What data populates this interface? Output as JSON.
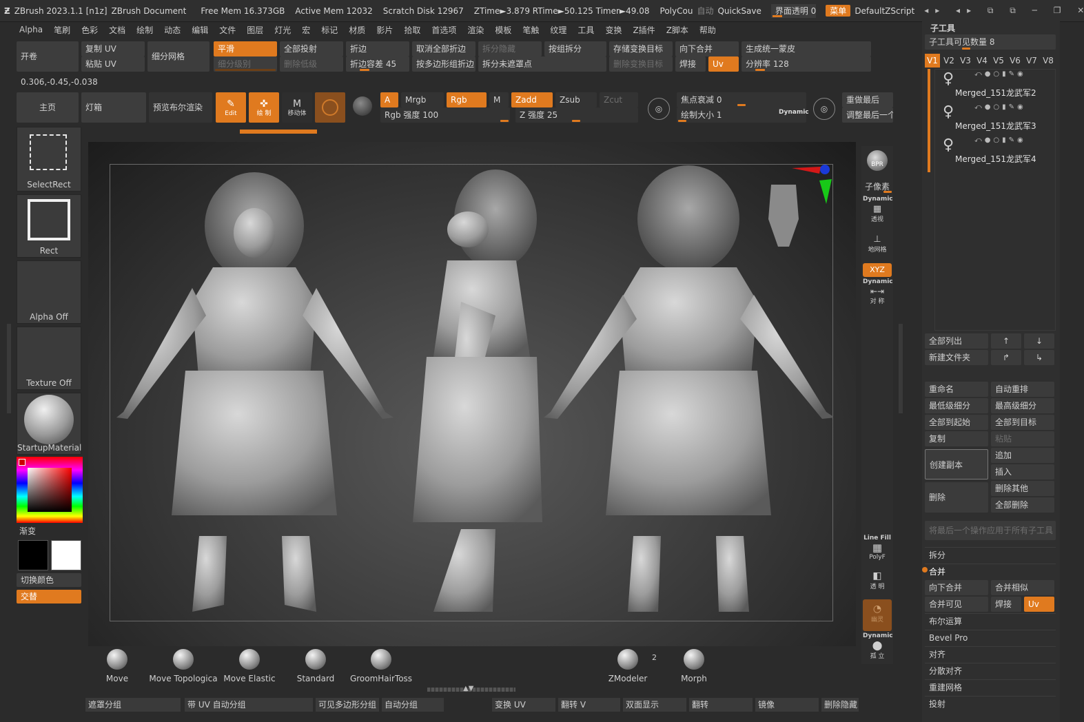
{
  "titlebar": {
    "app": "ZBrush 2023.1.1 [n1z]",
    "doc": "ZBrush Document",
    "free_mem": "Free Mem 16.373GB",
    "active_mem": "Active Mem 12032",
    "scratch": "Scratch Disk 12967",
    "ztime": "ZTime►3.879 RTime►50.125 Timer►49.08",
    "polycount": "PolyCou",
    "auto": "自动",
    "quicksave": "QuickSave",
    "transparency": "界面透明 0",
    "menu": "菜单",
    "script": "DefaultZScript"
  },
  "menu": [
    "Alpha",
    "笔刷",
    "色彩",
    "文档",
    "绘制",
    "动态",
    "编辑",
    "文件",
    "图层",
    "灯光",
    "宏",
    "标记",
    "材质",
    "影片",
    "拾取",
    "首选项",
    "渲染",
    "模板",
    "笔触",
    "纹理",
    "工具",
    "变换",
    "Z插件",
    "Z脚本",
    "帮助"
  ],
  "toolbar1": {
    "kaijuan": "开卷",
    "copy_uv": "复制 UV",
    "paste_uv": "粘贴 UV",
    "subdivide": "细分网格",
    "smooth": "平滑",
    "sub_level": "细分级别",
    "project_all": "全部投射",
    "del_lower": "删除低级",
    "crease": "折边",
    "crease_tol": "折边容差 45",
    "uncrease_all": "取消全部折边",
    "crease_pg": "按多边形组折边",
    "split_hidden": "拆分隐藏",
    "split_unmasked": "拆分未遮罩点",
    "groups_split": "按组拆分",
    "store_morph": "存储变换目标",
    "del_morph": "删除变换目标",
    "merge_down": "向下合并",
    "weld": "焊接",
    "uv": "Uv",
    "unified_skin": "生成统一蒙皮",
    "resolution": "分辨率 128"
  },
  "coords": "0.306,-0.45,-0.038",
  "toolbar2": {
    "home": "主页",
    "lightbox": "灯箱",
    "bpr_preview": "预览布尔渲染",
    "edit": "Edit",
    "draw": "绘 制",
    "move": "移动体",
    "a": "A",
    "mrgb": "Mrgb",
    "rgb": "Rgb",
    "m": "M",
    "zadd": "Zadd",
    "zsub": "Zsub",
    "zcut": "Zcut",
    "rgb_intensity": "Rgb 强度 100",
    "z_intensity": "Z 强度 25",
    "focal": "焦点衰减 0",
    "draw_size": "绘制大小 1",
    "dynamic": "Dynamic",
    "redo_last": "重做最后",
    "adjust_last": "调整最后一个"
  },
  "left_tiles": {
    "select_rect": "SelectRect",
    "rect": "Rect",
    "alpha": "Alpha Off",
    "texture": "Texture Off",
    "material": "StartupMaterial",
    "gradient": "渐变",
    "switch_color": "切换颜色",
    "alternate": "交替"
  },
  "brushes": [
    "Move",
    "Move Topologica",
    "Move Elastic",
    "Standard",
    "GroomHairToss",
    "ZModeler",
    "Morph"
  ],
  "zmodeler_badge": "2",
  "bottom_bar": [
    "遮罩分组",
    "带 UV 自动分组",
    "可见多边形分组",
    "自动分组",
    "变换 UV",
    "翻转 V",
    "双面显示",
    "翻转",
    "镜像",
    "删除隐藏"
  ],
  "right_shelf": {
    "bpr": "BPR",
    "subpixel": "子像素",
    "dynamic": "Dynamic",
    "persp": "透视",
    "floor": "地网格",
    "xyz": "XYZ",
    "dynamic2": "Dynamic",
    "sym": "对 称",
    "linefill": "Line Fill",
    "polyf": "PolyF",
    "transp": "透 明",
    "ghost": "幽灵",
    "dynamic3": "Dynamic",
    "solo": "孤 立"
  },
  "subtool": {
    "title": "子工具",
    "visible_count": "子工具可见数量 8",
    "versions": [
      "V1",
      "V2",
      "V3",
      "V4",
      "V5",
      "V6",
      "V7",
      "V8"
    ],
    "items": [
      "Merged_151龙武军2",
      "Merged_151龙武军3",
      "Merged_151龙武军4"
    ],
    "list_all": "全部列出",
    "new_folder": "新建文件夹",
    "rename": "重命名",
    "auto_reorder": "自动重排",
    "lowest_sub": "最低级细分",
    "highest_sub": "最高级细分",
    "all_to_start": "全部到起始",
    "all_to_target": "全部到目标",
    "duplicate": "复制",
    "paste": "粘贴",
    "create_copy": "创建副本",
    "append": "追加",
    "insert": "插入",
    "delete": "删除",
    "delete_other": "删除其他",
    "delete_all": "全部删除",
    "apply_all": "将最后一个操作应用于所有子工具",
    "split": "拆分",
    "merge": "合并",
    "merge_down": "向下合并",
    "merge_similar": "合并相似",
    "merge_visible": "合并可见",
    "weld": "焊接",
    "uv": "Uv",
    "boolean": "布尔运算",
    "bevel_pro": "Bevel Pro",
    "align": "对齐",
    "distribute": "分散对齐",
    "remesh": "重建网格",
    "project": "投射"
  }
}
